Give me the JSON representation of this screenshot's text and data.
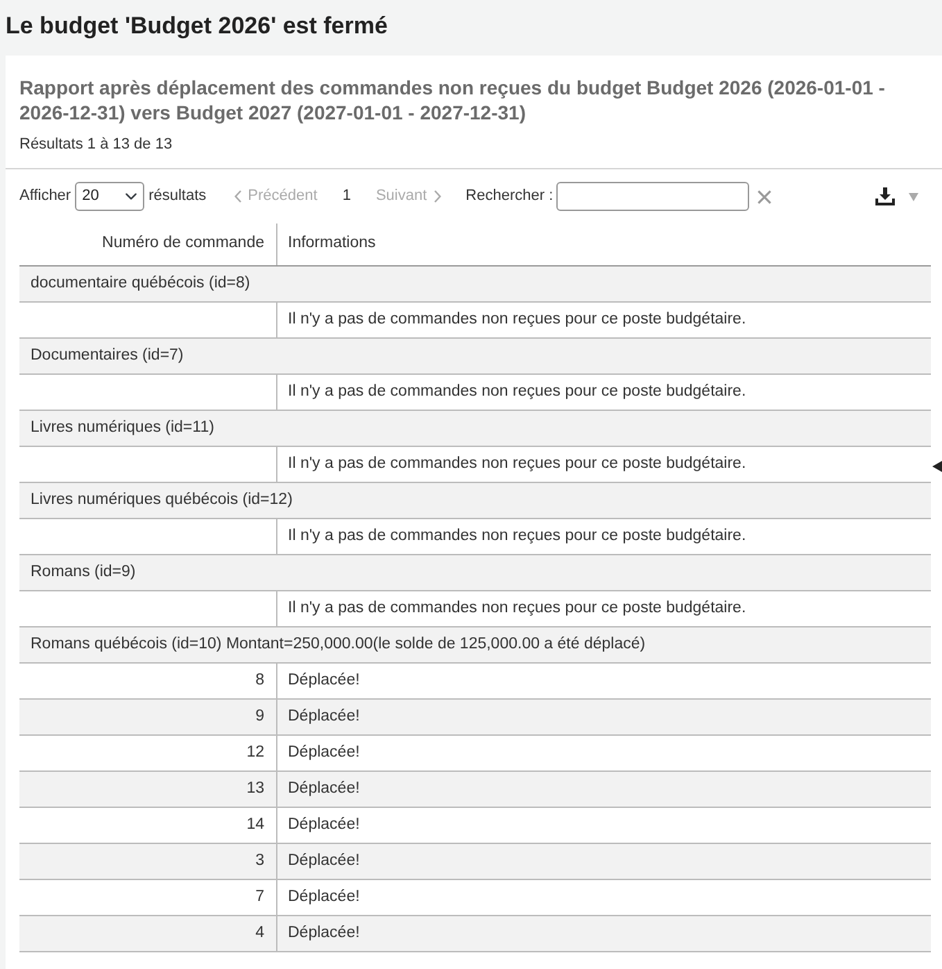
{
  "page_title": "Le budget 'Budget 2026' est fermé",
  "report": {
    "title": "Rapport après déplacement des commandes non reçues du budget Budget 2026 (2026-01-01 - 2026-12-31) vers Budget 2027 (2027-01-01 - 2027-12-31)",
    "results_summary": "Résultats 1 à 13 de 13"
  },
  "toolbar": {
    "show_label": "Afficher",
    "page_size": "20",
    "show_suffix": "résultats",
    "previous": {
      "label": "Précédent",
      "disabled": true
    },
    "pages": [
      {
        "label": "1",
        "selected": true
      }
    ],
    "next": {
      "label": "Suivant",
      "disabled": true
    },
    "search_label": "Rechercher :"
  },
  "table": {
    "columns": [
      "Numéro de commande",
      "Informations"
    ],
    "rows": [
      {
        "kind": "group",
        "label": "documentaire québécois (id=8)"
      },
      {
        "kind": "detail",
        "info": "Il n'y a pas de commandes non reçues pour ce poste budgétaire."
      },
      {
        "kind": "group",
        "label": "Documentaires (id=7)"
      },
      {
        "kind": "detail",
        "info": "Il n'y a pas de commandes non reçues pour ce poste budgétaire."
      },
      {
        "kind": "group",
        "label": "Livres numériques (id=11)"
      },
      {
        "kind": "detail",
        "info": "Il n'y a pas de commandes non reçues pour ce poste budgétaire."
      },
      {
        "kind": "group",
        "label": "Livres numériques québécois (id=12)"
      },
      {
        "kind": "detail",
        "info": "Il n'y a pas de commandes non reçues pour ce poste budgétaire."
      },
      {
        "kind": "group",
        "label": "Romans (id=9)"
      },
      {
        "kind": "detail",
        "info": "Il n'y a pas de commandes non reçues pour ce poste budgétaire."
      },
      {
        "kind": "group",
        "label": "Romans québécois (id=10) Montant=250,000.00(le solde de 125,000.00 a été déplacé)"
      },
      {
        "kind": "detail",
        "order": "8",
        "info": "Déplacée!"
      },
      {
        "kind": "detail",
        "order": "9",
        "info": "Déplacée!"
      },
      {
        "kind": "detail",
        "order": "12",
        "info": "Déplacée!"
      },
      {
        "kind": "detail",
        "order": "13",
        "info": "Déplacée!"
      },
      {
        "kind": "detail",
        "order": "14",
        "info": "Déplacée!"
      },
      {
        "kind": "detail",
        "order": "3",
        "info": "Déplacée!"
      },
      {
        "kind": "detail",
        "order": "7",
        "info": "Déplacée!"
      },
      {
        "kind": "detail",
        "order": "4",
        "info": "Déplacée!"
      }
    ]
  }
}
